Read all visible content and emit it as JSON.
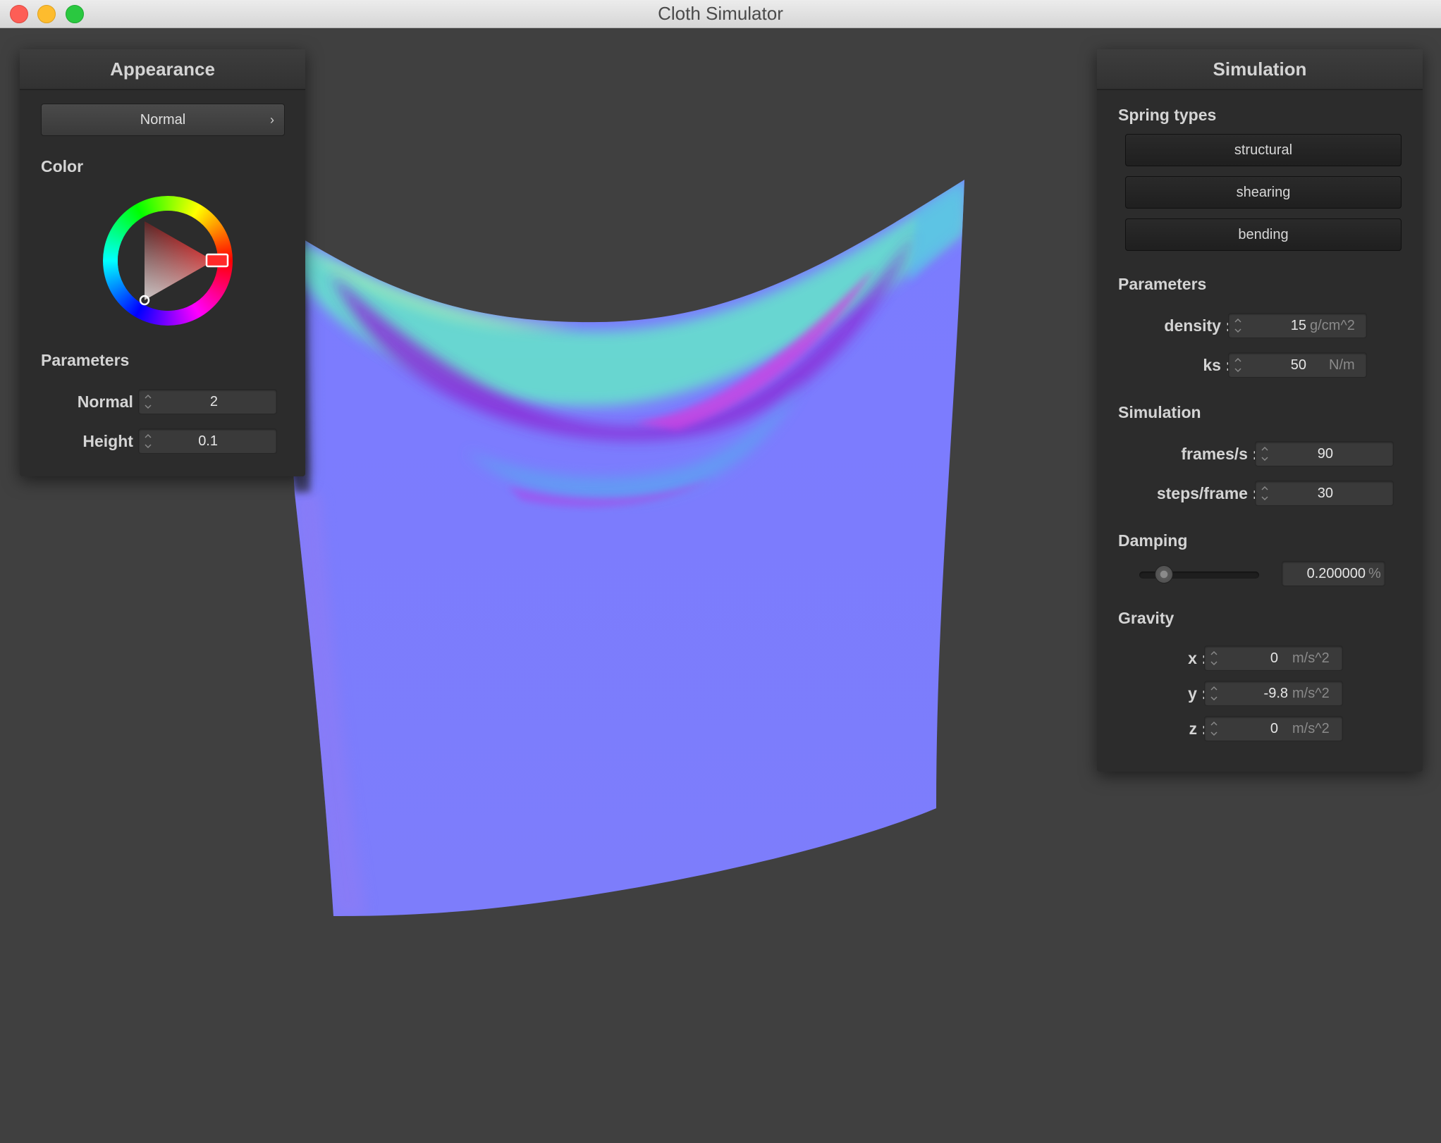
{
  "window": {
    "title": "Cloth Simulator"
  },
  "appearance": {
    "header": "Appearance",
    "shader_mode": "Normal",
    "color_label": "Color",
    "selected_color": "#ff0000",
    "parameters_label": "Parameters",
    "normal": {
      "label": "Normal :",
      "value": "2"
    },
    "height": {
      "label": "Height :",
      "value": "0.1"
    }
  },
  "simulation": {
    "header": "Simulation",
    "spring_types": {
      "label": "Spring types",
      "buttons": [
        "structural",
        "shearing",
        "bending"
      ]
    },
    "parameters": {
      "label": "Parameters",
      "density": {
        "label": "density :",
        "value": "15",
        "unit": "g/cm^2"
      },
      "ks": {
        "label": "ks :",
        "value": "50",
        "unit": "N/m"
      }
    },
    "simulation": {
      "label": "Simulation",
      "fps": {
        "label": "frames/s :",
        "value": "90"
      },
      "steps": {
        "label": "steps/frame :",
        "value": "30"
      }
    },
    "damping": {
      "label": "Damping",
      "value": "0.200000",
      "unit": "%",
      "slider_fraction": 0.2
    },
    "gravity": {
      "label": "Gravity",
      "x": {
        "label": "x :",
        "value": "0",
        "unit": "m/s^2"
      },
      "y": {
        "label": "y :",
        "value": "-9.8",
        "unit": "m/s^2"
      },
      "z": {
        "label": "z :",
        "value": "0",
        "unit": "m/s^2"
      }
    }
  }
}
